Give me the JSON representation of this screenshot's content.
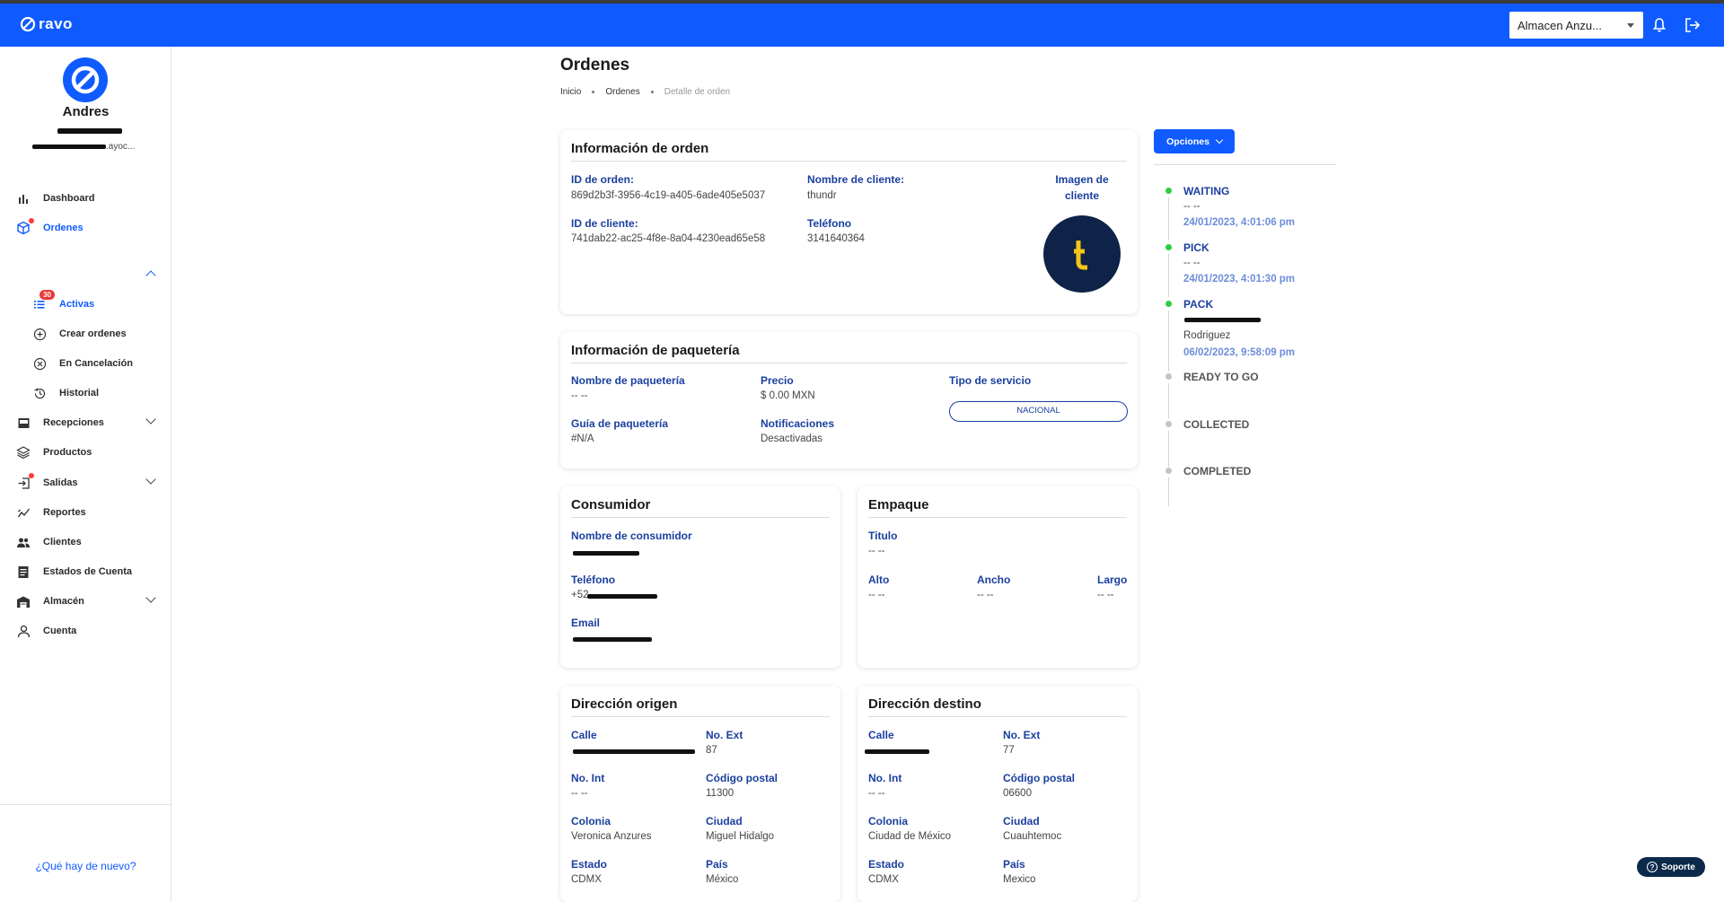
{
  "app": {
    "logo_text": "ravo",
    "store_select": "Almacen Anzu...",
    "primary_color": "#0f5bff"
  },
  "user": {
    "name": "Andres",
    "email_suffix": ".ayoc..."
  },
  "sidebar": {
    "dashboard": "Dashboard",
    "ordenes": "Ordenes",
    "activas": "Activas",
    "activas_count": "30",
    "crear": "Crear ordenes",
    "cancelacion": "En Cancelación",
    "historial": "Historial",
    "recepciones": "Recepciones",
    "productos": "Productos",
    "salidas": "Salidas",
    "reportes": "Reportes",
    "clientes": "Clientes",
    "estados": "Estados de Cuenta",
    "almacen": "Almacén",
    "cuenta": "Cuenta",
    "whats_new": "¿Qué hay de nuevo?"
  },
  "page": {
    "title": "Ordenes",
    "breadcrumb": [
      "Inicio",
      "Ordenes",
      "Detalle de orden"
    ]
  },
  "order_info": {
    "title": "Información de orden",
    "order_id_label": "ID de orden:",
    "order_id": "869d2b3f-3956-4c19-a405-6ade405e5037",
    "client_id_label": "ID de cliente:",
    "client_id": "741dab22-ac25-4f8e-8a04-4230ead65e58",
    "client_name_label": "Nombre de cliente:",
    "client_name": "thundr",
    "phone_label": "Teléfono",
    "phone": "3141640364",
    "image_label": "Imagen de cliente"
  },
  "shipping": {
    "title": "Información de paquetería",
    "carrier_label": "Nombre de paquetería",
    "carrier": "-- --",
    "price_label": "Precio",
    "price": "$ 0.00 MXN",
    "service_label": "Tipo de servicio",
    "service": "NACIONAL",
    "guide_label": "Guía de paquetería",
    "guide": "#N/A",
    "notif_label": "Notificaciones",
    "notif": "Desactivadas"
  },
  "consumer": {
    "title": "Consumidor",
    "name_label": "Nombre de consumidor",
    "phone_label": "Teléfono",
    "phone_prefix": "+52",
    "email_label": "Email"
  },
  "packaging": {
    "title": "Empaque",
    "title_label": "Titulo",
    "title_value": "-- --",
    "alto_label": "Alto",
    "alto": "-- --",
    "ancho_label": "Ancho",
    "ancho": "-- --",
    "largo_label": "Largo",
    "largo": "-- --"
  },
  "origin": {
    "title": "Dirección origen",
    "calle_label": "Calle",
    "ext_label": "No. Ext",
    "ext": "87",
    "int_label": "No. Int",
    "int": "-- --",
    "cp_label": "Código postal",
    "cp": "11300",
    "colonia_label": "Colonia",
    "colonia": "Veronica Anzures",
    "ciudad_label": "Ciudad",
    "ciudad": "Miguel Hidalgo",
    "estado_label": "Estado",
    "estado": "CDMX",
    "pais_label": "País",
    "pais": "México"
  },
  "destination": {
    "title": "Dirección destino",
    "calle_label": "Calle",
    "ext_label": "No. Ext",
    "ext": "77",
    "int_label": "No. Int",
    "int": "-- --",
    "cp_label": "Código postal",
    "cp": "06600",
    "colonia_label": "Colonia",
    "colonia": "Ciudad de México",
    "ciudad_label": "Ciudad",
    "ciudad": "Cuauhtemoc",
    "estado_label": "Estado",
    "estado": "CDMX",
    "pais_label": "País",
    "pais": "Mexico"
  },
  "options_button": "Opciones",
  "timeline": [
    {
      "status": "WAITING",
      "user": "-- --",
      "date": "24/01/2023, 4:01:06 pm",
      "done": true
    },
    {
      "status": "PICK",
      "user": "-- --",
      "date": "24/01/2023, 4:01:30 pm",
      "done": true
    },
    {
      "status": "PACK",
      "user": "Rodriguez",
      "date": "06/02/2023, 9:58:09 pm",
      "done": true
    },
    {
      "status": "READY TO GO",
      "done": false
    },
    {
      "status": "COLLECTED",
      "done": false
    },
    {
      "status": "COMPLETED",
      "done": false
    }
  ],
  "support_label": "Soporte"
}
